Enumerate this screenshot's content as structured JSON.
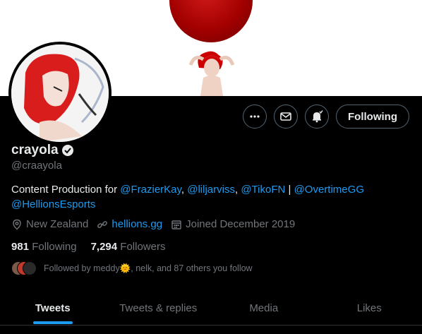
{
  "profile": {
    "display_name": "crayola",
    "handle": "@craayola",
    "bio": {
      "prefix": "Content Production for ",
      "links": [
        "@FrazierKay",
        "@liljarviss",
        "@TikoFN",
        "@OvertimeGG",
        "@HellionsEsports"
      ],
      "sep1": ", ",
      "sep2": ", ",
      "sep3": " | "
    },
    "location": "New Zealand",
    "website": "hellions.gg",
    "joined": "Joined December 2019",
    "following_count": "981",
    "following_label": "Following",
    "followers_count": "7,294",
    "followers_label": "Followers",
    "followed_by": "Followed by meddy🌞, nelk, and 87 others you follow"
  },
  "actions": {
    "follow_label": "Following"
  },
  "tabs": [
    "Tweets",
    "Tweets & replies",
    "Media",
    "Likes"
  ],
  "colors": {
    "accent": "#1d9bf0",
    "background": "#000000",
    "text": "#e7e9ea",
    "muted": "#71767b",
    "banner_moon": "#b30000"
  },
  "icons": [
    "more-icon",
    "message-icon",
    "notification-bell-icon",
    "verified-badge-icon",
    "location-icon",
    "link-icon",
    "calendar-icon"
  ]
}
